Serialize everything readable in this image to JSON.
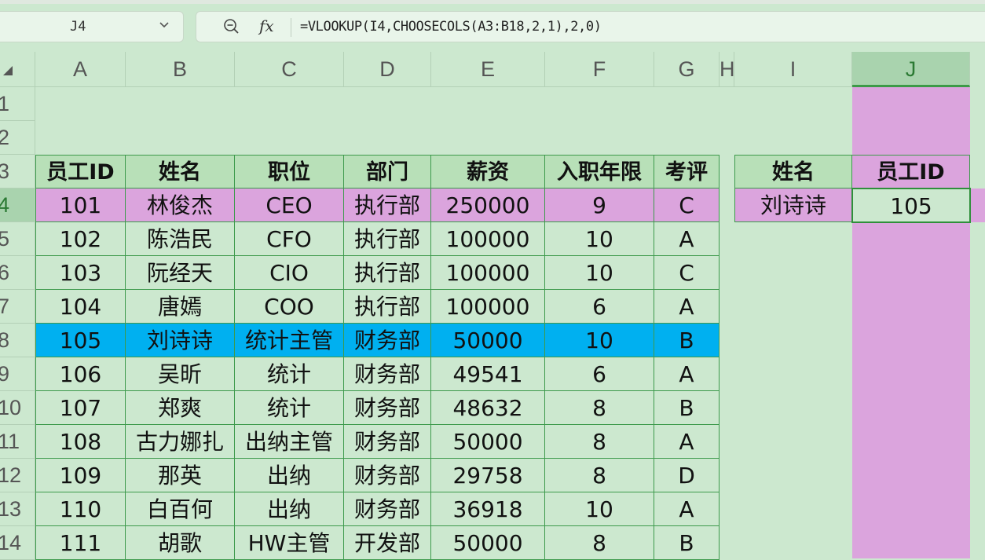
{
  "name_box": "J4",
  "formula": "=VLOOKUP(I4,CHOOSECOLS(A3:B18,2,1),2,0)",
  "columns": [
    "A",
    "B",
    "C",
    "D",
    "E",
    "F",
    "G",
    "H",
    "I",
    "J"
  ],
  "rows": [
    "1",
    "2",
    "3",
    "4",
    "5",
    "6",
    "7",
    "8",
    "9",
    "10",
    "11",
    "12",
    "13",
    "14"
  ],
  "table": {
    "headers": [
      "员工ID",
      "姓名",
      "职位",
      "部门",
      "薪资",
      "入职年限",
      "考评"
    ],
    "rows": [
      [
        "101",
        "林俊杰",
        "CEO",
        "执行部",
        "250000",
        "9",
        "C"
      ],
      [
        "102",
        "陈浩民",
        "CFO",
        "执行部",
        "100000",
        "10",
        "A"
      ],
      [
        "103",
        "阮经天",
        "CIO",
        "执行部",
        "100000",
        "10",
        "C"
      ],
      [
        "104",
        "唐嫣",
        "COO",
        "执行部",
        "100000",
        "6",
        "A"
      ],
      [
        "105",
        "刘诗诗",
        "统计主管",
        "财务部",
        "50000",
        "10",
        "B"
      ],
      [
        "106",
        "吴昕",
        "统计",
        "财务部",
        "49541",
        "6",
        "A"
      ],
      [
        "107",
        "郑爽",
        "统计",
        "财务部",
        "48632",
        "8",
        "B"
      ],
      [
        "108",
        "古力娜扎",
        "出纳主管",
        "财务部",
        "50000",
        "8",
        "A"
      ],
      [
        "109",
        "那英",
        "出纳",
        "财务部",
        "29758",
        "8",
        "D"
      ],
      [
        "110",
        "白百何",
        "出纳",
        "财务部",
        "36918",
        "10",
        "A"
      ],
      [
        "111",
        "胡歌",
        "HW主管",
        "开发部",
        "50000",
        "8",
        "B"
      ]
    ]
  },
  "lookup": {
    "header_name": "姓名",
    "header_id": "员工ID",
    "name": "刘诗诗",
    "id": "105"
  },
  "colors": {
    "grid_bg": "#cce8cf",
    "highlight_purple": "#dba4dd",
    "highlight_blue": "#00b0f0",
    "table_border": "#3d9a4c",
    "header_fill": "#b8e0b8"
  },
  "icons": [
    "zoom-icon",
    "fx-icon",
    "chevron-down-icon",
    "select-all-icon"
  ]
}
